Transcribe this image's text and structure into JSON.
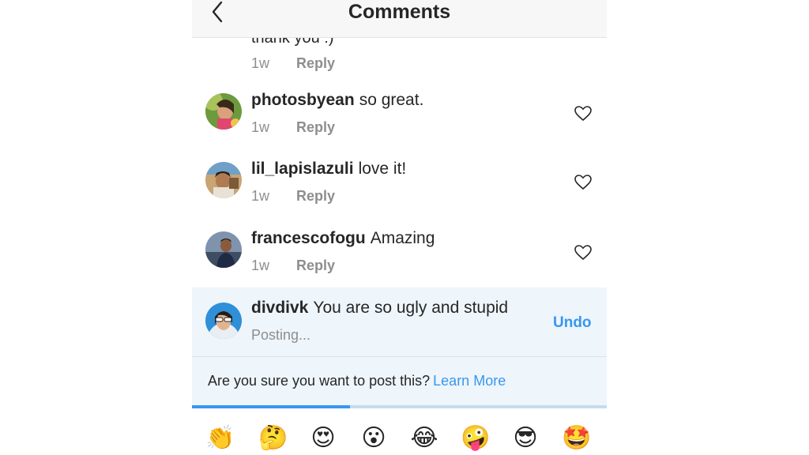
{
  "header": {
    "title": "Comments"
  },
  "partial_comment": {
    "text": "thank you :)",
    "time": "1w",
    "reply_label": "Reply"
  },
  "comments": [
    {
      "username": "photosbyean",
      "text": "so great.",
      "time": "1w",
      "reply_label": "Reply"
    },
    {
      "username": "lil_lapislazuli",
      "text": "love it!",
      "time": "1w",
      "reply_label": "Reply"
    },
    {
      "username": "francescofogu",
      "text": "Amazing",
      "time": "1w",
      "reply_label": "Reply"
    }
  ],
  "pending_comment": {
    "username": "divdivk",
    "text": "You are so ugly and stupid",
    "status": "Posting...",
    "undo_label": "Undo"
  },
  "warning": {
    "text": "Are you sure you want to post this?",
    "link_label": "Learn More"
  },
  "progress": {
    "value": 0.38
  },
  "emoji_bar": [
    "👏",
    "🤔",
    "😍",
    "😮",
    "😂",
    "🤪",
    "😎",
    "🤩"
  ],
  "colors": {
    "accent": "#3897f0",
    "muted": "#8e8e8e",
    "pending_bg": "#eef5fb"
  }
}
